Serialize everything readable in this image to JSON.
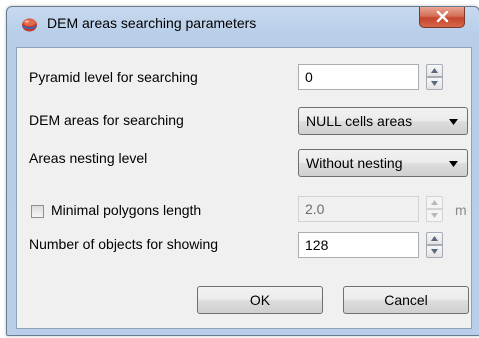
{
  "window": {
    "title": "DEM areas searching parameters",
    "icon": "app-globe-icon",
    "close_icon": "close-x-icon"
  },
  "form": {
    "pyramid_level": {
      "label": "Pyramid level for searching",
      "value": "0"
    },
    "dem_areas": {
      "label": "DEM areas for searching",
      "selected": "NULL cells areas"
    },
    "nesting_level": {
      "label": "Areas nesting level",
      "selected": "Without nesting"
    },
    "min_polygon_length": {
      "label": "Minimal polygons length",
      "checked": false,
      "value": "2.0",
      "unit": "m"
    },
    "num_objects": {
      "label": "Number of objects for showing",
      "value": "128"
    }
  },
  "buttons": {
    "ok": "OK",
    "cancel": "Cancel"
  },
  "colors": {
    "titlebar": "#b9cfe9",
    "close": "#c5452b",
    "client": "#f0f0f0"
  }
}
